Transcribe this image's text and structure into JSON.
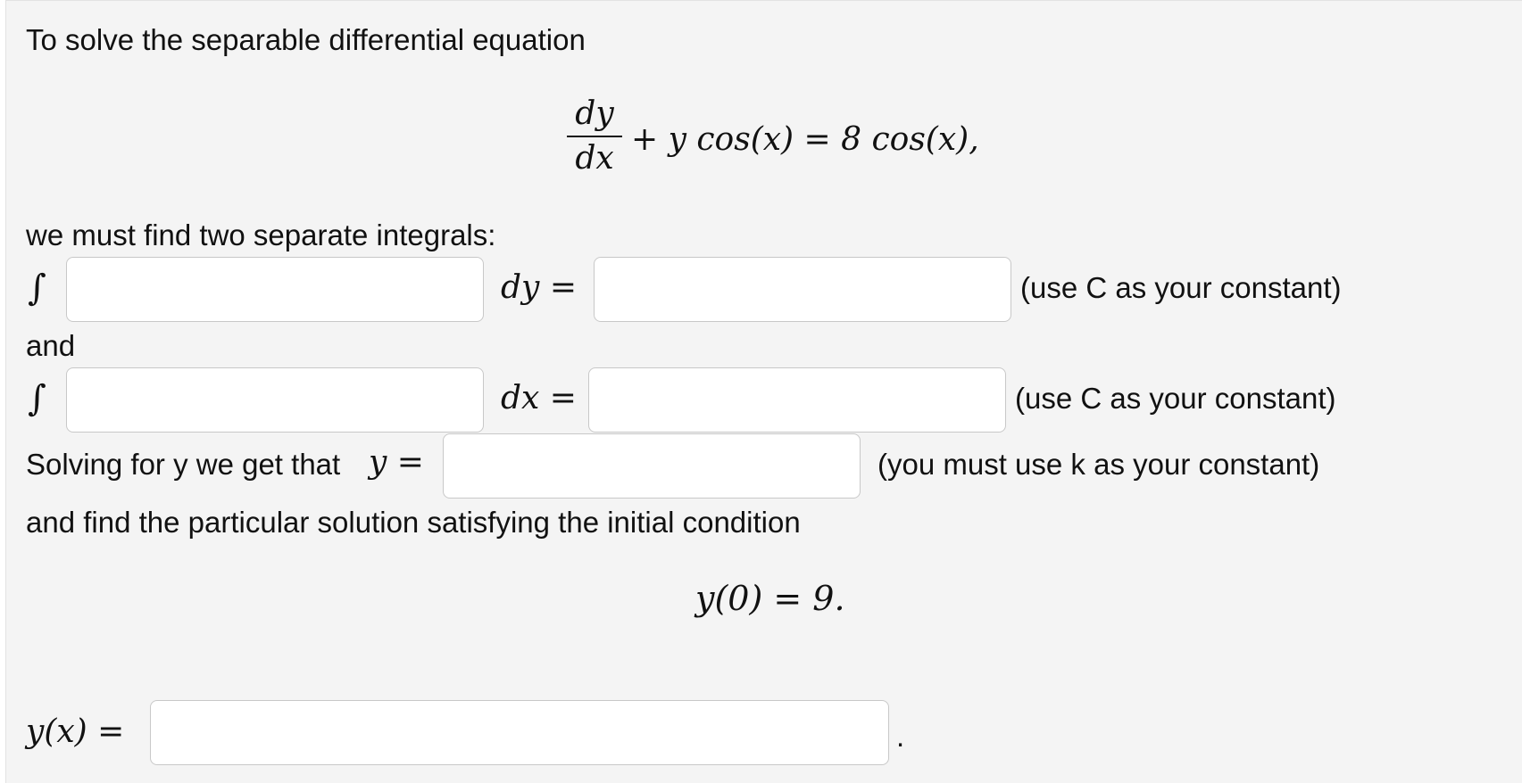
{
  "intro": "To solve the separable differential equation",
  "equation": {
    "numerator": "dy",
    "denominator": "dx",
    "rest": "+ y cos(x) = 8 cos(x),"
  },
  "must_find": "we must find two separate integrals:",
  "integral_symbol": "∫",
  "row1": {
    "differential": "dy =",
    "hint": "(use C as your constant)",
    "left_value": "",
    "right_value": ""
  },
  "and_label": "and",
  "row2": {
    "differential": "dx =",
    "hint": "(use C as your constant)",
    "left_value": "",
    "right_value": ""
  },
  "solving": {
    "prefix": "Solving for y we get that",
    "variable": "y =",
    "hint": "(you must use k as your constant)",
    "value": ""
  },
  "particular": "and find the particular solution satisfying the initial condition",
  "initial_condition": "y(0) = 9.",
  "final": {
    "label": "y(x) =",
    "value": "",
    "period": "."
  }
}
